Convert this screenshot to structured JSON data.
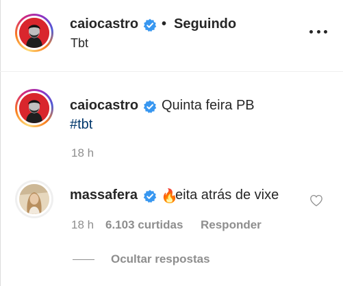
{
  "header": {
    "username": "caiocastro",
    "separator": "•",
    "follow_status": "Seguindo",
    "location": "Tbt",
    "more_icon": "more-horizontal-icon"
  },
  "caption": {
    "username": "caiocastro",
    "text": "Quinta feira PB",
    "hashtag": "#tbt",
    "time": "18 h"
  },
  "comment": {
    "username": "massafera",
    "emoji": "🔥",
    "text": "eita atrás de vixe",
    "time": "18 h",
    "likes": "6.103 curtidas",
    "reply": "Responder",
    "like_icon": "heart-outline-icon"
  },
  "replies": {
    "hide_label": "Ocultar respostas"
  },
  "colors": {
    "verified_blue": "#3897f0",
    "hashtag_blue": "#00376b",
    "muted_gray": "#8e8e8e",
    "text": "#262626"
  }
}
